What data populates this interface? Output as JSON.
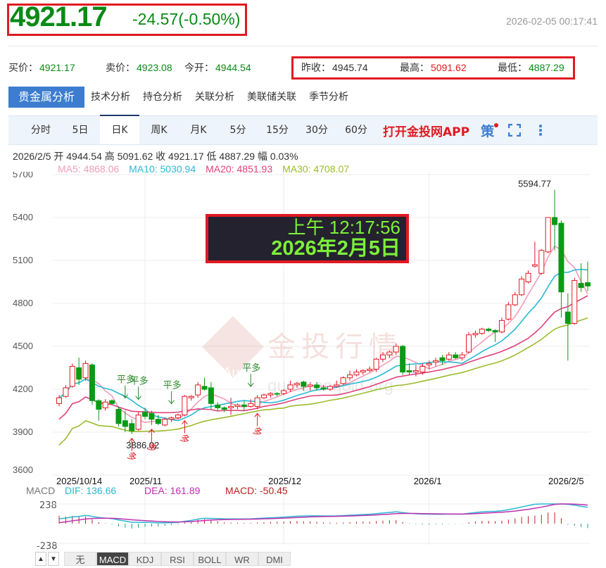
{
  "header": {
    "price": "4921.17",
    "change": "-24.57(-0.50%)",
    "timestamp": "2026-02-05 00:17:41"
  },
  "quotes": [
    {
      "label": "买价：",
      "value": "4921.17",
      "color": "green"
    },
    {
      "label": "卖价：",
      "value": "4923.08",
      "color": "green"
    },
    {
      "label": "今开：",
      "value": "4944.54",
      "color": "green"
    },
    {
      "label": "昨收：",
      "value": "4945.74",
      "color": "dark"
    },
    {
      "label": "最高：",
      "value": "5091.62",
      "color": "red"
    },
    {
      "label": "最低：",
      "value": "4887.29",
      "color": "green"
    }
  ],
  "tabs": [
    "贵金属分析",
    "技术分析",
    "持仓分析",
    "关联分析",
    "美联储关联",
    "季节分析"
  ],
  "periods": [
    "分时",
    "5日",
    "日K",
    "周K",
    "月K",
    "5分",
    "15分",
    "30分",
    "60分"
  ],
  "active_period": "日K",
  "app_link": "打开金投网APP",
  "strategy_icon": "策",
  "info": "2026/2/5  开 4944.54  高 5091.62  收 4921.17  低 4887.29  幅 0.03%",
  "ma": [
    {
      "label": "MA5: 4868.06",
      "color": "#f29cb8"
    },
    {
      "label": "MA10: 5030.94",
      "color": "#2ab8d6"
    },
    {
      "label": "MA20: 4851.93",
      "color": "#e0407a"
    },
    {
      "label": "MA30: 4708.07",
      "color": "#9cbb2c"
    }
  ],
  "overlay": {
    "time": "上午 12:17:56",
    "date": "2026年2月5日"
  },
  "watermark": {
    "text": "金投行情",
    "url": "quote.cngold.org",
    "logo": "Au"
  },
  "colors": {
    "up": "#e01a22",
    "down": "#0a9a16",
    "grid": "#ececec"
  },
  "chart_data": {
    "type": "candlestick",
    "y_ticks": [
      5700,
      5400,
      5100,
      4800,
      4500,
      4200,
      3900,
      3600
    ],
    "ylim": [
      3600,
      5700
    ],
    "x_labels": [
      {
        "i": 0,
        "label": "2025/10/14"
      },
      {
        "i": 13,
        "label": "2025/11"
      },
      {
        "i": 34,
        "label": "2025/12"
      },
      {
        "i": 56,
        "label": "2026/1"
      },
      {
        "i": 80,
        "label": "2026/2/5"
      }
    ],
    "max_label": {
      "i": 75,
      "value": "5594.77"
    },
    "min_label": {
      "i": 11,
      "value": "3886.02"
    },
    "ohlc": [
      [
        4100,
        4160,
        4080,
        4140
      ],
      [
        4150,
        4230,
        4140,
        4210
      ],
      [
        4220,
        4380,
        4210,
        4360
      ],
      [
        4350,
        4420,
        4230,
        4270
      ],
      [
        4280,
        4400,
        4260,
        4380
      ],
      [
        4370,
        4380,
        4090,
        4120
      ],
      [
        4120,
        4130,
        3980,
        4060
      ],
      [
        4070,
        4130,
        4050,
        4110
      ],
      [
        4120,
        4130,
        4090,
        4100
      ],
      [
        4060,
        4080,
        3940,
        3960
      ],
      [
        3980,
        4050,
        3900,
        3940
      ],
      [
        3960,
        3990,
        3886,
        3910
      ],
      [
        3920,
        4040,
        3910,
        4020
      ],
      [
        4040,
        4070,
        3990,
        4010
      ],
      [
        4030,
        4050,
        3950,
        3990
      ],
      [
        3990,
        4020,
        3950,
        3960
      ],
      [
        3950,
        4000,
        3940,
        3990
      ],
      [
        3990,
        4010,
        3970,
        4000
      ],
      [
        4000,
        4030,
        3990,
        4020
      ],
      [
        4020,
        4160,
        4010,
        4150
      ],
      [
        4140,
        4160,
        4120,
        4150
      ],
      [
        4160,
        4250,
        4140,
        4230
      ],
      [
        4220,
        4280,
        4190,
        4200
      ],
      [
        4210,
        4250,
        4060,
        4100
      ],
      [
        4090,
        4110,
        4050,
        4070
      ],
      [
        4070,
        4080,
        4040,
        4060
      ],
      [
        4070,
        4140,
        4020,
        4080
      ],
      [
        4080,
        4100,
        4060,
        4090
      ],
      [
        4090,
        4120,
        4050,
        4080
      ],
      [
        4080,
        4130,
        4070,
        4100
      ],
      [
        4080,
        4160,
        4060,
        4140
      ],
      [
        4140,
        4170,
        4130,
        4160
      ],
      [
        4160,
        4180,
        4140,
        4170
      ],
      [
        4170,
        4180,
        4150,
        4165
      ],
      [
        4170,
        4200,
        4160,
        4190
      ],
      [
        4200,
        4260,
        4180,
        4230
      ],
      [
        4230,
        4250,
        4210,
        4240
      ],
      [
        4250,
        4260,
        4190,
        4220
      ],
      [
        4220,
        4250,
        4190,
        4230
      ],
      [
        4230,
        4250,
        4190,
        4210
      ],
      [
        4210,
        4230,
        4190,
        4200
      ],
      [
        4200,
        4230,
        4190,
        4220
      ],
      [
        4220,
        4260,
        4210,
        4230
      ],
      [
        4240,
        4290,
        4230,
        4280
      ],
      [
        4280,
        4330,
        4260,
        4300
      ],
      [
        4300,
        4340,
        4290,
        4320
      ],
      [
        4320,
        4340,
        4300,
        4330
      ],
      [
        4330,
        4360,
        4320,
        4340
      ],
      [
        4340,
        4420,
        4320,
        4410
      ],
      [
        4410,
        4460,
        4390,
        4440
      ],
      [
        4440,
        4470,
        4420,
        4460
      ],
      [
        4460,
        4520,
        4440,
        4500
      ],
      [
        4500,
        4510,
        4300,
        4320
      ],
      [
        4330,
        4380,
        4300,
        4320
      ],
      [
        4320,
        4370,
        4290,
        4330
      ],
      [
        4320,
        4380,
        4300,
        4360
      ],
      [
        4370,
        4400,
        4340,
        4380
      ],
      [
        4390,
        4420,
        4360,
        4400
      ],
      [
        4420,
        4440,
        4370,
        4400
      ],
      [
        4410,
        4460,
        4400,
        4440
      ],
      [
        4440,
        4460,
        4410,
        4420
      ],
      [
        4420,
        4460,
        4400,
        4440
      ],
      [
        4460,
        4600,
        4450,
        4580
      ],
      [
        4580,
        4610,
        4560,
        4590
      ],
      [
        4590,
        4630,
        4580,
        4620
      ],
      [
        4620,
        4630,
        4600,
        4610
      ],
      [
        4610,
        4620,
        4530,
        4600
      ],
      [
        4600,
        4700,
        4590,
        4680
      ],
      [
        4690,
        4810,
        4680,
        4790
      ],
      [
        4790,
        4880,
        4780,
        4860
      ],
      [
        4860,
        4990,
        4850,
        4970
      ],
      [
        4950,
        5030,
        4940,
        5010
      ],
      [
        5060,
        5230,
        5050,
        5070
      ],
      [
        5010,
        5180,
        5000,
        5170
      ],
      [
        5160,
        5400,
        5150,
        5400
      ],
      [
        5400,
        5594.77,
        5170,
        5350
      ],
      [
        5360,
        5380,
        4700,
        4880
      ],
      [
        4740,
        4870,
        4400,
        4660
      ],
      [
        4660,
        4980,
        4650,
        4960
      ],
      [
        4940,
        5080,
        4880,
        4910
      ],
      [
        4944.54,
        5091.62,
        4887.29,
        4921.17
      ]
    ],
    "signals": [
      {
        "i": 10,
        "text": "平多",
        "type": "close"
      },
      {
        "i": 12,
        "text": "平多",
        "type": "close"
      },
      {
        "i": 17,
        "text": "平多",
        "type": "close"
      },
      {
        "i": 29,
        "text": "平多",
        "type": "close"
      },
      {
        "i": 11,
        "text": "多",
        "type": "open"
      },
      {
        "i": 14,
        "text": "多",
        "type": "open"
      },
      {
        "i": 19,
        "text": "多",
        "type": "open"
      },
      {
        "i": 30,
        "text": "多",
        "type": "open"
      }
    ]
  },
  "macd": {
    "label": "MACD",
    "dif": "DIF: 136.66",
    "dea": "DEA: 161.89",
    "macd": "MACD: -50.45",
    "ticks": [
      "238",
      "-238"
    ]
  },
  "indicator_tabs": [
    "无",
    "MACD",
    "KDJ",
    "RSI",
    "BOLL",
    "WR",
    "DMI"
  ],
  "active_indicator": "MACD"
}
